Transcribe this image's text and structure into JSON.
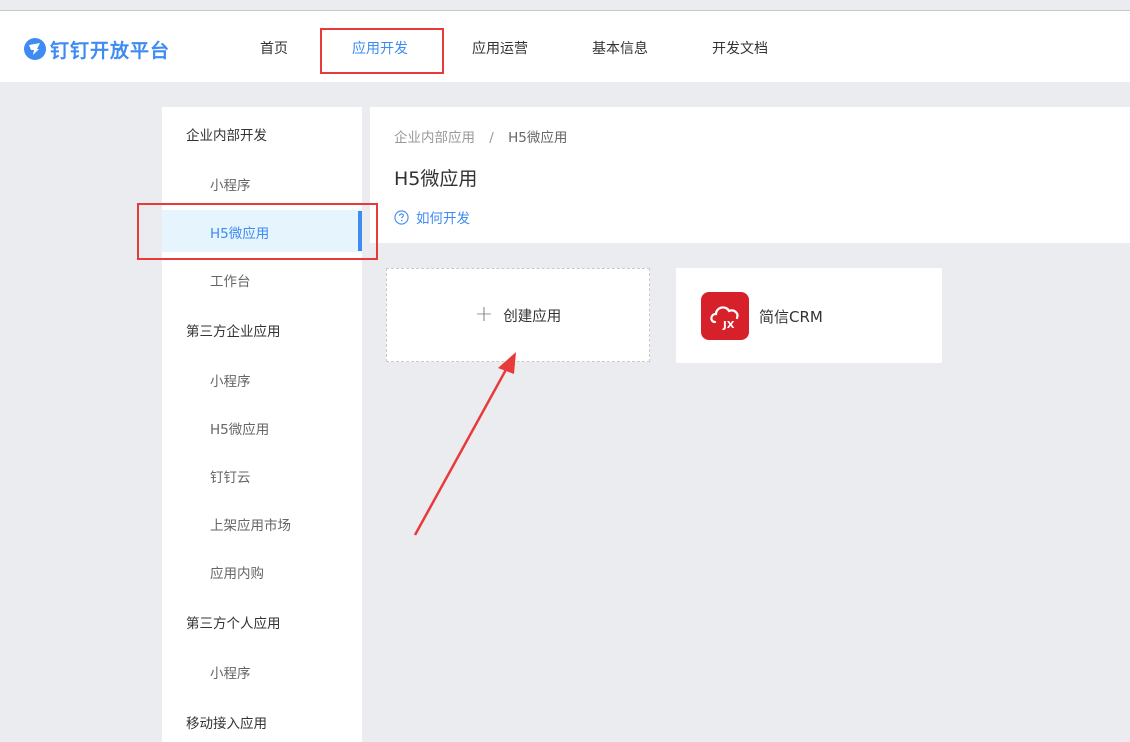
{
  "header": {
    "logo_text": "钉钉开放平台",
    "nav": [
      {
        "label": "首页"
      },
      {
        "label": "应用开发",
        "active": true
      },
      {
        "label": "应用运营"
      },
      {
        "label": "基本信息"
      },
      {
        "label": "开发文档"
      }
    ]
  },
  "sidebar": {
    "groups": [
      {
        "label": "企业内部开发",
        "items": [
          {
            "label": "小程序"
          },
          {
            "label": "H5微应用",
            "active": true
          },
          {
            "label": "工作台"
          }
        ]
      },
      {
        "label": "第三方企业应用",
        "items": [
          {
            "label": "小程序"
          },
          {
            "label": "H5微应用"
          },
          {
            "label": "钉钉云"
          },
          {
            "label": "上架应用市场"
          },
          {
            "label": "应用内购"
          }
        ]
      },
      {
        "label": "第三方个人应用",
        "items": [
          {
            "label": "小程序"
          }
        ]
      },
      {
        "label": "移动接入应用",
        "items": []
      }
    ]
  },
  "content": {
    "breadcrumb": [
      "企业内部应用",
      "H5微应用"
    ],
    "breadcrumb_sep": "/",
    "title": "H5微应用",
    "help_link": "如何开发",
    "create_card": {
      "plus": "+",
      "label": "创建应用"
    },
    "apps": [
      {
        "name": "简信CRM",
        "icon": "cloud-jx-icon",
        "icon_text": "JX",
        "color": "#d6202a"
      }
    ]
  },
  "colors": {
    "accent": "#3e8bf2",
    "annotation": "#e83a3a"
  }
}
